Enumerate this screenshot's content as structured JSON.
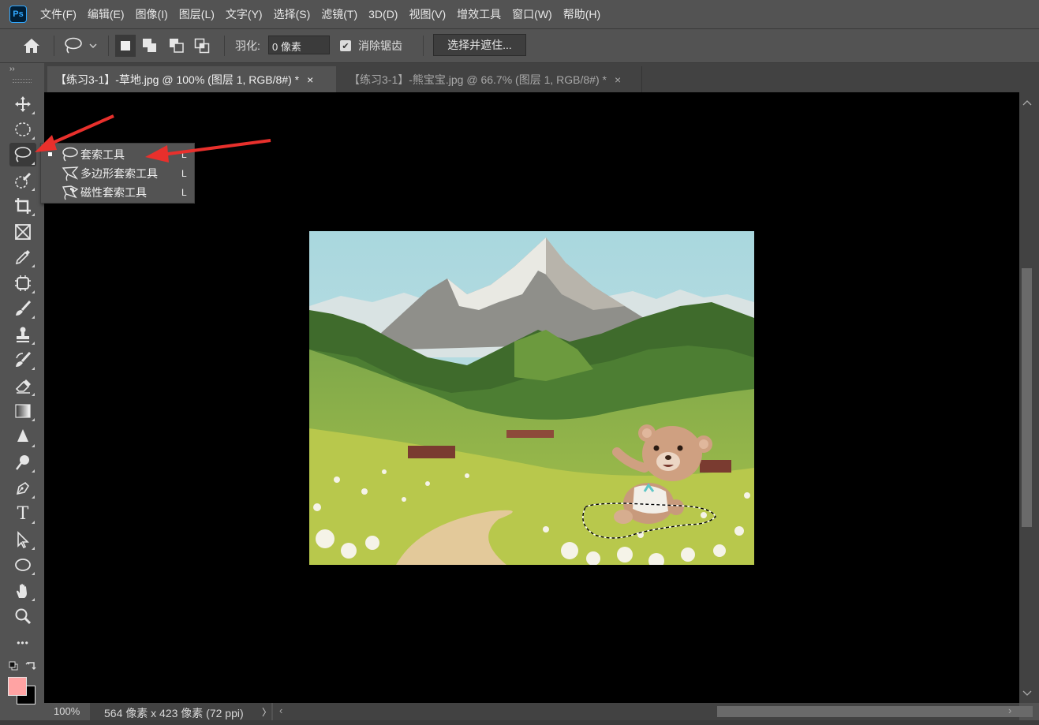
{
  "app": {
    "logo_text": "Ps"
  },
  "menubar": {
    "items": [
      "文件(F)",
      "编辑(E)",
      "图像(I)",
      "图层(L)",
      "文字(Y)",
      "选择(S)",
      "滤镜(T)",
      "3D(D)",
      "视图(V)",
      "增效工具",
      "窗口(W)",
      "帮助(H)"
    ]
  },
  "options": {
    "feather_label": "羽化:",
    "feather_value": "0 像素",
    "antialias_label": "消除锯齿",
    "antialias_checked": true,
    "select_mask_label": "选择并遮住..."
  },
  "tabs": [
    {
      "title": "【练习3-1】-草地.jpg @ 100% (图层 1, RGB/8#) *",
      "close": "×",
      "active": true
    },
    {
      "title": "【练习3-1】-熊宝宝.jpg @ 66.7% (图层 1, RGB/8#) *",
      "close": "×",
      "active": false
    }
  ],
  "toolbar": {
    "collapse_label": "››",
    "text_tool_glyph": "T",
    "more_glyph": "•••",
    "foreground_color": "#ffa3a3",
    "background_color": "#000000"
  },
  "flyout": {
    "items": [
      {
        "label": "套索工具",
        "shortcut": "L",
        "icon": "lasso-icon",
        "selected": true
      },
      {
        "label": "多边形套索工具",
        "shortcut": "L",
        "icon": "polygonal-lasso-icon",
        "selected": false
      },
      {
        "label": "磁性套索工具",
        "shortcut": "L",
        "icon": "magnetic-lasso-icon",
        "selected": false
      }
    ]
  },
  "status": {
    "zoom": "100%",
    "doc_info": "564 像素 x 423 像素 (72 ppi)",
    "more": "〉",
    "scroll_left": "‹",
    "scroll_right": "›"
  },
  "colors": {
    "annotation_arrow": "#e8302c",
    "ui_bg": "#535353",
    "canvas_bg": "#000000"
  }
}
